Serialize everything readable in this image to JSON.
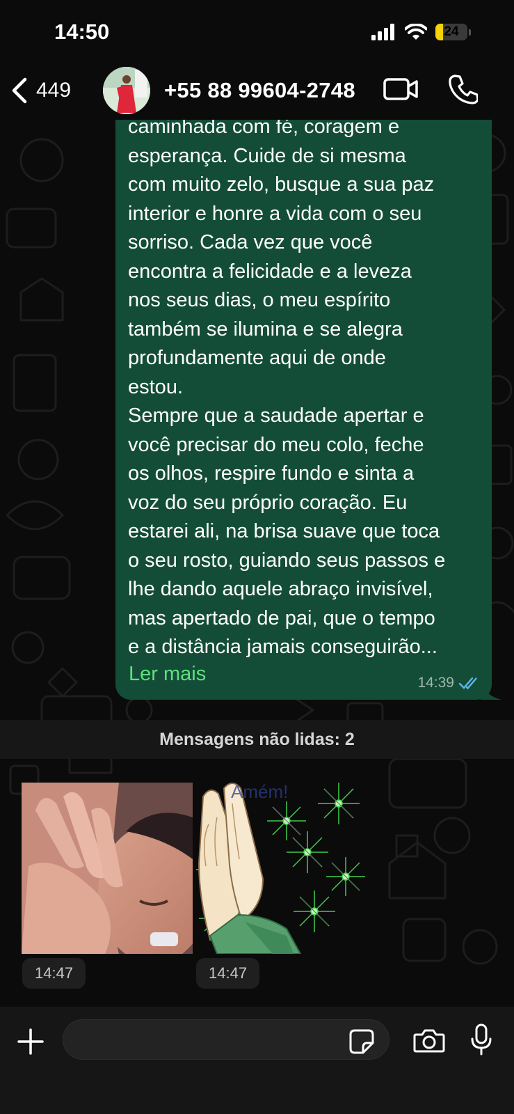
{
  "status_bar": {
    "time": "14:50",
    "battery_text": "24",
    "battery_level": 0.24,
    "battery_color": "#f5d20a"
  },
  "header": {
    "back_count": "449",
    "contact_name": "+55 88 99604-2748",
    "icons": [
      "chevron-left-icon",
      "video-camera-icon",
      "phone-icon"
    ]
  },
  "outgoing_message": {
    "text": "caminhada com fé, coragem e\nesperança. Cuide de si mesma\ncom muito zelo, busque a sua paz\ninterior e honre a vida com o seu\nsorriso. Cada vez que você\nencontra a felicidade e a leveza\nnos seus dias, o meu espírito\ntambém se ilumina e se alegra\nprofundamente aqui de onde\nestou.\nSempre que a saudade apertar e\nvocê precisar do meu colo, feche\nos olhos, respire fundo e sinta a\nvoz do seu próprio coração. Eu\nestarei ali, na brisa suave que toca\no seu rosto, guiando seus passos e\nlhe dando aquele abraço invisível,\nmas apertado de pai, que o tempo\ne a distância jamais conseguirão...",
    "read_more": "Ler mais",
    "time": "14:39",
    "status": "read",
    "bubble_color": "#144d37",
    "link_color": "#5ee07f"
  },
  "unread_banner": "Mensagens não lidas: 2",
  "incoming_stickers": [
    {
      "description_icon": "child-face-sticker",
      "time": "14:47"
    },
    {
      "description_icon": "praying-hands-sticker",
      "overlay_text": "Amém!",
      "time": "14:47"
    }
  ],
  "input_bar": {
    "placeholder": "",
    "icons": [
      "plus-icon",
      "sticker-icon",
      "camera-icon",
      "microphone-icon"
    ]
  }
}
